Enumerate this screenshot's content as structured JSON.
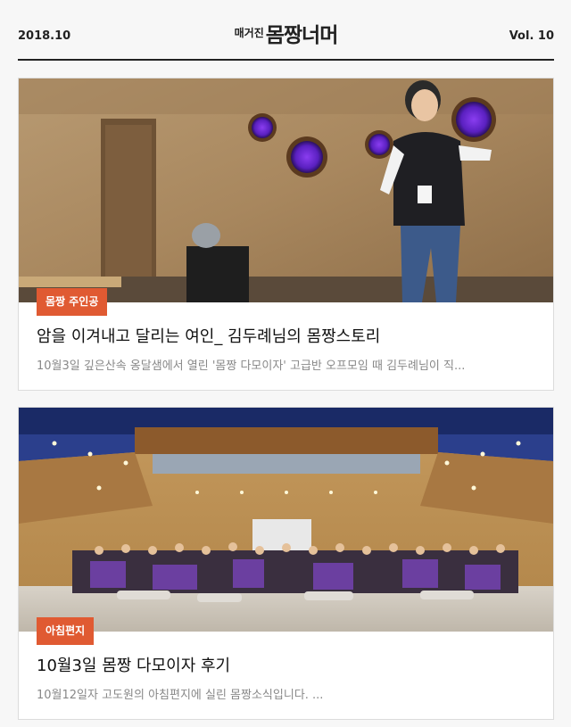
{
  "header": {
    "issue_date": "2018.10",
    "brand_small": "매거진",
    "brand_big": "몸짱너머",
    "volume": "Vol. 10"
  },
  "articles": [
    {
      "category": "몸짱 주인공",
      "title": "암을 이겨내고 달리는 여인_ 김두례님의 몸짱스토리",
      "summary": "10월3일 깊은산속 옹달샘에서 열린 '몸짱 다모이자' 고급반 오프모임 때 김두례님이 직..."
    },
    {
      "category": "아침편지",
      "title": "10월3일 몸짱 다모이자 후기",
      "summary": "10월12일자 고도원의 아침편지에 실린 몸짱소식입니다. ..."
    }
  ],
  "colors": {
    "badge": "#e05a32",
    "rule": "#222222",
    "summary_text": "#888888"
  }
}
